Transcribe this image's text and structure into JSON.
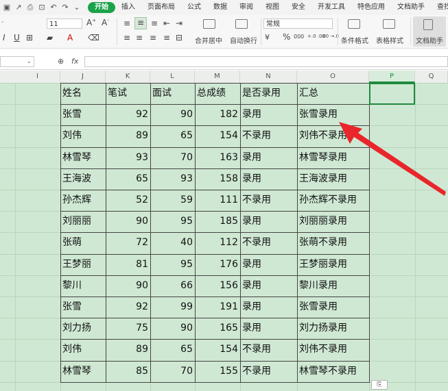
{
  "menu": {
    "tabs": [
      "开始",
      "插入",
      "页面布局",
      "公式",
      "数据",
      "审阅",
      "视图",
      "安全",
      "开发工具",
      "特色应用",
      "文档助手",
      "查找"
    ],
    "active": "开始"
  },
  "ribbon": {
    "font_size": "11",
    "number_format": "常规",
    "merge_center": "合并居中",
    "wrap_text": "自动换行",
    "conditional_format": "条件格式",
    "table_style": "表格样式",
    "doc_helper": "文档助手",
    "percent_symbol": "%",
    "thousands_symbol": "000",
    "increase_decimal": "+.0 .00",
    "decrease_decimal": ".00 →.0"
  },
  "formula_bar": {
    "fx": "fx",
    "value": ""
  },
  "columns": [
    "I",
    "J",
    "K",
    "L",
    "M",
    "N",
    "O",
    "P",
    "Q"
  ],
  "selected_column": "P",
  "table": {
    "headers": [
      "姓名",
      "笔试",
      "面试",
      "总成绩",
      "是否录用",
      "汇总"
    ],
    "rows": [
      [
        "张雪",
        "92",
        "90",
        "182",
        "录用",
        "张雪录用"
      ],
      [
        "刘伟",
        "89",
        "65",
        "154",
        "不录用",
        "刘伟不录用"
      ],
      [
        "林雪琴",
        "93",
        "70",
        "163",
        "录用",
        "林雪琴录用"
      ],
      [
        "王海波",
        "65",
        "93",
        "158",
        "录用",
        "王海波录用"
      ],
      [
        "孙杰辉",
        "52",
        "59",
        "111",
        "不录用",
        "孙杰辉不录用"
      ],
      [
        "刘丽丽",
        "90",
        "95",
        "185",
        "录用",
        "刘丽丽录用"
      ],
      [
        "张萌",
        "72",
        "40",
        "112",
        "不录用",
        "张萌不录用"
      ],
      [
        "王梦丽",
        "81",
        "95",
        "176",
        "录用",
        "王梦丽录用"
      ],
      [
        "黎川",
        "90",
        "66",
        "156",
        "录用",
        "黎川录用"
      ],
      [
        "张雪",
        "92",
        "99",
        "191",
        "录用",
        "张雪录用"
      ],
      [
        "刘力扬",
        "75",
        "90",
        "165",
        "录用",
        "刘力扬录用"
      ],
      [
        "刘伟",
        "89",
        "65",
        "154",
        "不录用",
        "刘伟不录用"
      ],
      [
        "林雪琴",
        "85",
        "70",
        "155",
        "不录用",
        "林雪琴不录用"
      ]
    ]
  },
  "paste_options": "⎘",
  "colors": {
    "accent": "#1aa34a",
    "sheet_bg": "#cfe8d3",
    "arrow": "#e8262b"
  }
}
